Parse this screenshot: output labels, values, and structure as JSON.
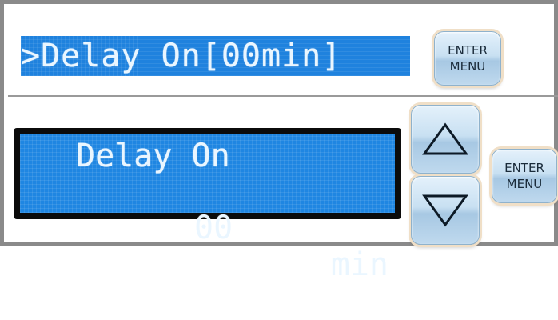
{
  "screen_top": {
    "lcd_text": ">Delay On[00min]",
    "enter_button": {
      "line1": "ENTER",
      "line2": "MENU"
    }
  },
  "screen_bottom": {
    "lcd_line1": "Delay On",
    "value": "00",
    "unit": "min",
    "up_button_icon": "triangle-up-icon",
    "down_button_icon": "triangle-down-icon",
    "enter_button": {
      "line1": "ENTER",
      "line2": "MENU"
    }
  },
  "colors": {
    "lcd_background": "#1f82de",
    "lcd_text": "#eaf6ff",
    "bezel": "#0b0b0b",
    "button_face": "#c8e0f2"
  }
}
